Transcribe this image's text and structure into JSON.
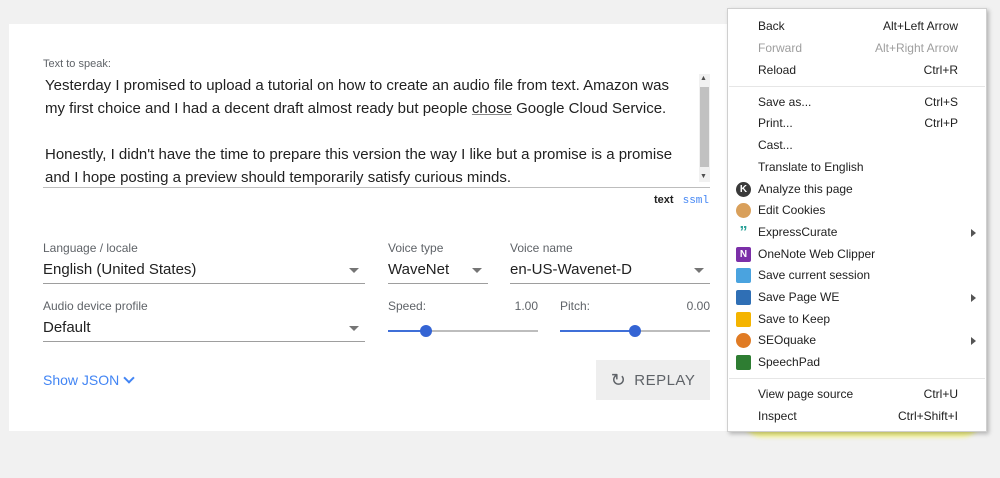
{
  "tts": {
    "label": "Text to speak:",
    "para1_a": "Yesterday I promised to upload a tutorial on how to create an audio file from text. Amazon was my first choice and I had a decent draft almost ready but people ",
    "para1_u": "chose",
    "para1_b": " Google Cloud Service.",
    "para2": "Honestly, I didn't have the time to prepare this version the way I like but a promise is a promise and I hope posting a preview should temporarily satisfy curious minds.",
    "format_text": "text",
    "format_ssml": "ssml"
  },
  "language": {
    "label": "Language / locale",
    "value": "English (United States)"
  },
  "voice_type": {
    "label": "Voice type",
    "value": "WaveNet"
  },
  "voice_name": {
    "label": "Voice name",
    "value": "en-US-Wavenet-D"
  },
  "device": {
    "label": "Audio device profile",
    "value": "Default"
  },
  "speed": {
    "label": "Speed:",
    "value": "1.00",
    "fraction": 0.25
  },
  "pitch": {
    "label": "Pitch:",
    "value": "0.00",
    "fraction": 0.5
  },
  "show_json": "Show JSON",
  "replay": "REPLAY",
  "menu": {
    "back": {
      "label": "Back",
      "shortcut": "Alt+Left Arrow"
    },
    "forward": {
      "label": "Forward",
      "shortcut": "Alt+Right Arrow"
    },
    "reload": {
      "label": "Reload",
      "shortcut": "Ctrl+R"
    },
    "save_as": {
      "label": "Save as...",
      "shortcut": "Ctrl+S"
    },
    "print": {
      "label": "Print...",
      "shortcut": "Ctrl+P"
    },
    "cast": {
      "label": "Cast..."
    },
    "translate": {
      "label": "Translate to English"
    },
    "analyze": {
      "label": "Analyze this page",
      "icon": "K"
    },
    "edit_cookies": {
      "label": "Edit Cookies"
    },
    "expresscurate": {
      "label": "ExpressCurate",
      "icon": "”"
    },
    "onenote": {
      "label": "OneNote Web Clipper",
      "icon": "N"
    },
    "save_session": {
      "label": "Save current session"
    },
    "save_page_we": {
      "label": "Save Page WE"
    },
    "save_keep": {
      "label": "Save to Keep"
    },
    "seoquake": {
      "label": "SEOquake"
    },
    "speechpad": {
      "label": "SpeechPad"
    },
    "view_source": {
      "label": "View page source",
      "shortcut": "Ctrl+U"
    },
    "inspect": {
      "label": "Inspect",
      "shortcut": "Ctrl+Shift+I"
    }
  },
  "colors": {
    "accent": "#4285f4",
    "slider": "#3464d4",
    "highlight": "#f5f564"
  }
}
